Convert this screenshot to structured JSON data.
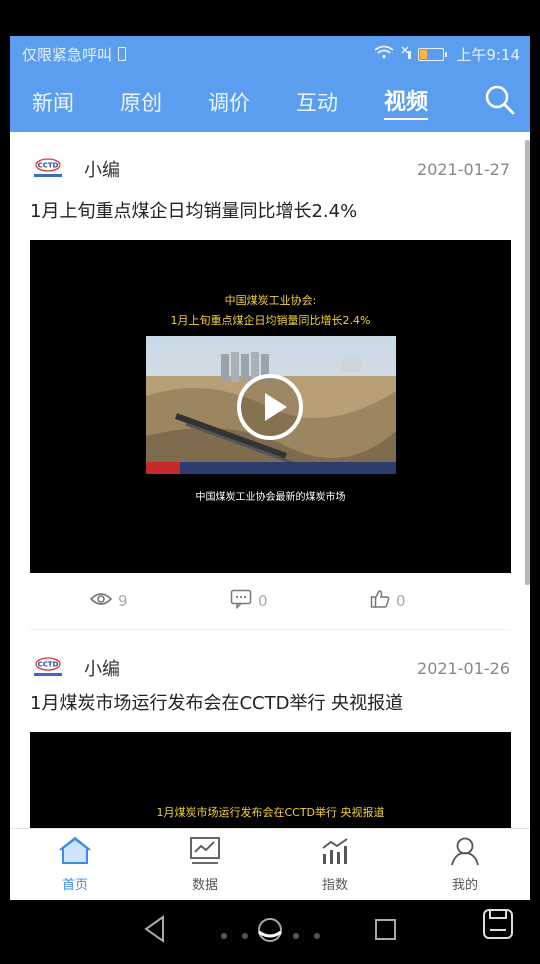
{
  "status": {
    "left_text": "仅限紧急呼叫",
    "time": "上午9:14"
  },
  "tabs": [
    {
      "label": "新闻"
    },
    {
      "label": "原创"
    },
    {
      "label": "调价"
    },
    {
      "label": "互动"
    },
    {
      "label": "视频",
      "active": true
    }
  ],
  "feed": [
    {
      "author": "小编",
      "date": "2021-01-27",
      "title": "1月上旬重点煤企日均销量同比增长2.4%",
      "video": {
        "line1": "中国煤炭工业协会:",
        "line2": "1月上旬重点煤企日均销量同比增长2.4%",
        "caption": "中国煤炭工业协会最新的煤炭市场"
      },
      "views": "9",
      "comments": "0",
      "likes": "0"
    },
    {
      "author": "小编",
      "date": "2021-01-26",
      "title": "1月煤炭市场运行发布会在CCTD举行 央视报道",
      "video": {
        "line1": "1月煤炭市场运行发布会在CCTD举行 央视报道"
      }
    }
  ],
  "bottom_nav": [
    {
      "label": "首页",
      "icon": "home-icon",
      "active": true
    },
    {
      "label": "数据",
      "icon": "chart-icon"
    },
    {
      "label": "指数",
      "icon": "index-icon"
    },
    {
      "label": "我的",
      "icon": "user-icon"
    }
  ],
  "colors": {
    "brand": "#5b9ef0",
    "active_nav": "#3b8de8"
  }
}
